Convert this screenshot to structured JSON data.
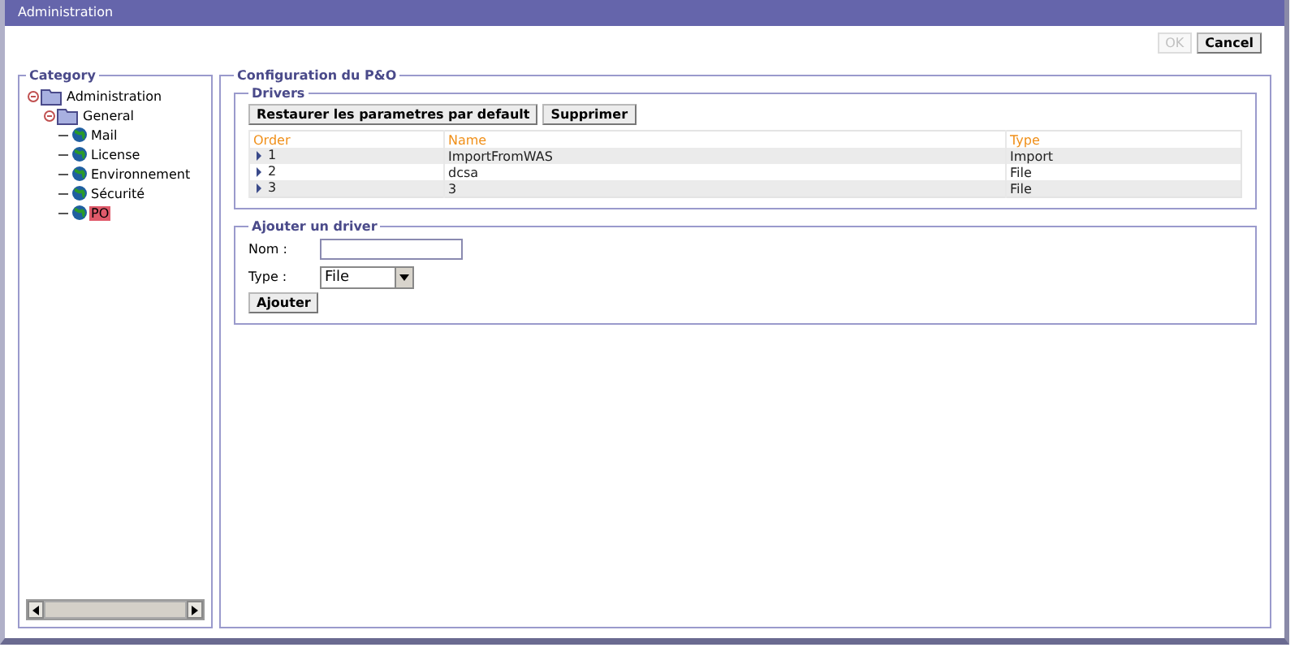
{
  "window": {
    "title": "Administration"
  },
  "buttons": [
    {
      "label": "OK",
      "disabled": true
    },
    {
      "label": "Cancel",
      "disabled": false
    }
  ],
  "category": {
    "title": "Category",
    "tree": [
      {
        "label": "Administration",
        "kind": "folder",
        "expanded": true,
        "selected": false,
        "children": [
          {
            "label": "General",
            "kind": "folder",
            "expanded": true,
            "selected": false,
            "children": [
              {
                "label": "Mail",
                "kind": "leaf",
                "selected": false
              },
              {
                "label": "License",
                "kind": "leaf",
                "selected": false
              },
              {
                "label": "Environnement",
                "kind": "leaf",
                "selected": false
              },
              {
                "label": "Sécurité",
                "kind": "leaf",
                "selected": false
              },
              {
                "label": "PO",
                "kind": "leaf",
                "selected": true
              }
            ]
          }
        ]
      }
    ]
  },
  "config": {
    "title": "Configuration du P&O",
    "drivers": {
      "title": "Drivers",
      "buttons": [
        "Restaurer les parametres par default",
        "Supprimer"
      ],
      "columns": [
        "Order",
        "Name",
        "Type"
      ],
      "rows": [
        {
          "order": "1",
          "name": "ImportFromWAS",
          "type": "Import"
        },
        {
          "order": "2",
          "name": "dcsa",
          "type": "File"
        },
        {
          "order": "3",
          "name": "3",
          "type": "File"
        }
      ]
    },
    "add": {
      "title": "Ajouter un driver",
      "name_label": "Nom :",
      "type_label": "Type :",
      "type_value": "File",
      "button": "Ajouter"
    }
  }
}
